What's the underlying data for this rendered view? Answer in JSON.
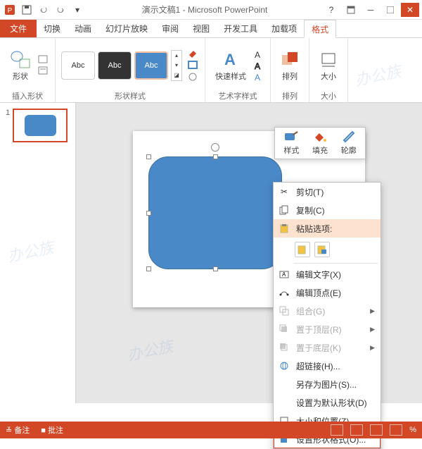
{
  "titlebar": {
    "title": "演示文稿1 - Microsoft PowerPoint"
  },
  "tabs": {
    "file": "文件",
    "items": [
      "切换",
      "动画",
      "幻灯片放映",
      "审阅",
      "视图",
      "开发工具",
      "加载项"
    ],
    "format": "格式"
  },
  "ribbon": {
    "insert_shape": {
      "label": "插入形状",
      "btn": "形状"
    },
    "style": {
      "label": "形状样式",
      "abc": "Abc"
    },
    "wordart": {
      "label": "艺术字样式",
      "btn": "快速样式"
    },
    "arrange": {
      "label": "排列",
      "btn": "排列"
    },
    "size": {
      "label": "大小",
      "btn": "大小"
    }
  },
  "thumb": {
    "num": "1"
  },
  "mini": {
    "style": "样式",
    "fill": "填充",
    "outline": "轮廓"
  },
  "ctx": {
    "cut": "剪切(T)",
    "copy": "复制(C)",
    "paste_label": "粘贴选项:",
    "edit_text": "编辑文字(X)",
    "edit_points": "编辑顶点(E)",
    "group": "组合(G)",
    "bring_front": "置于顶层(R)",
    "send_back": "置于底层(K)",
    "hyperlink": "超链接(H)...",
    "save_as_pic": "另存为图片(S)...",
    "set_default": "设置为默认形状(D)",
    "size_pos": "大小和位置(Z)...",
    "format_shape": "设置形状格式(O)..."
  },
  "status": {
    "notes": "备注",
    "comments": "批注",
    "zoom": "%"
  }
}
